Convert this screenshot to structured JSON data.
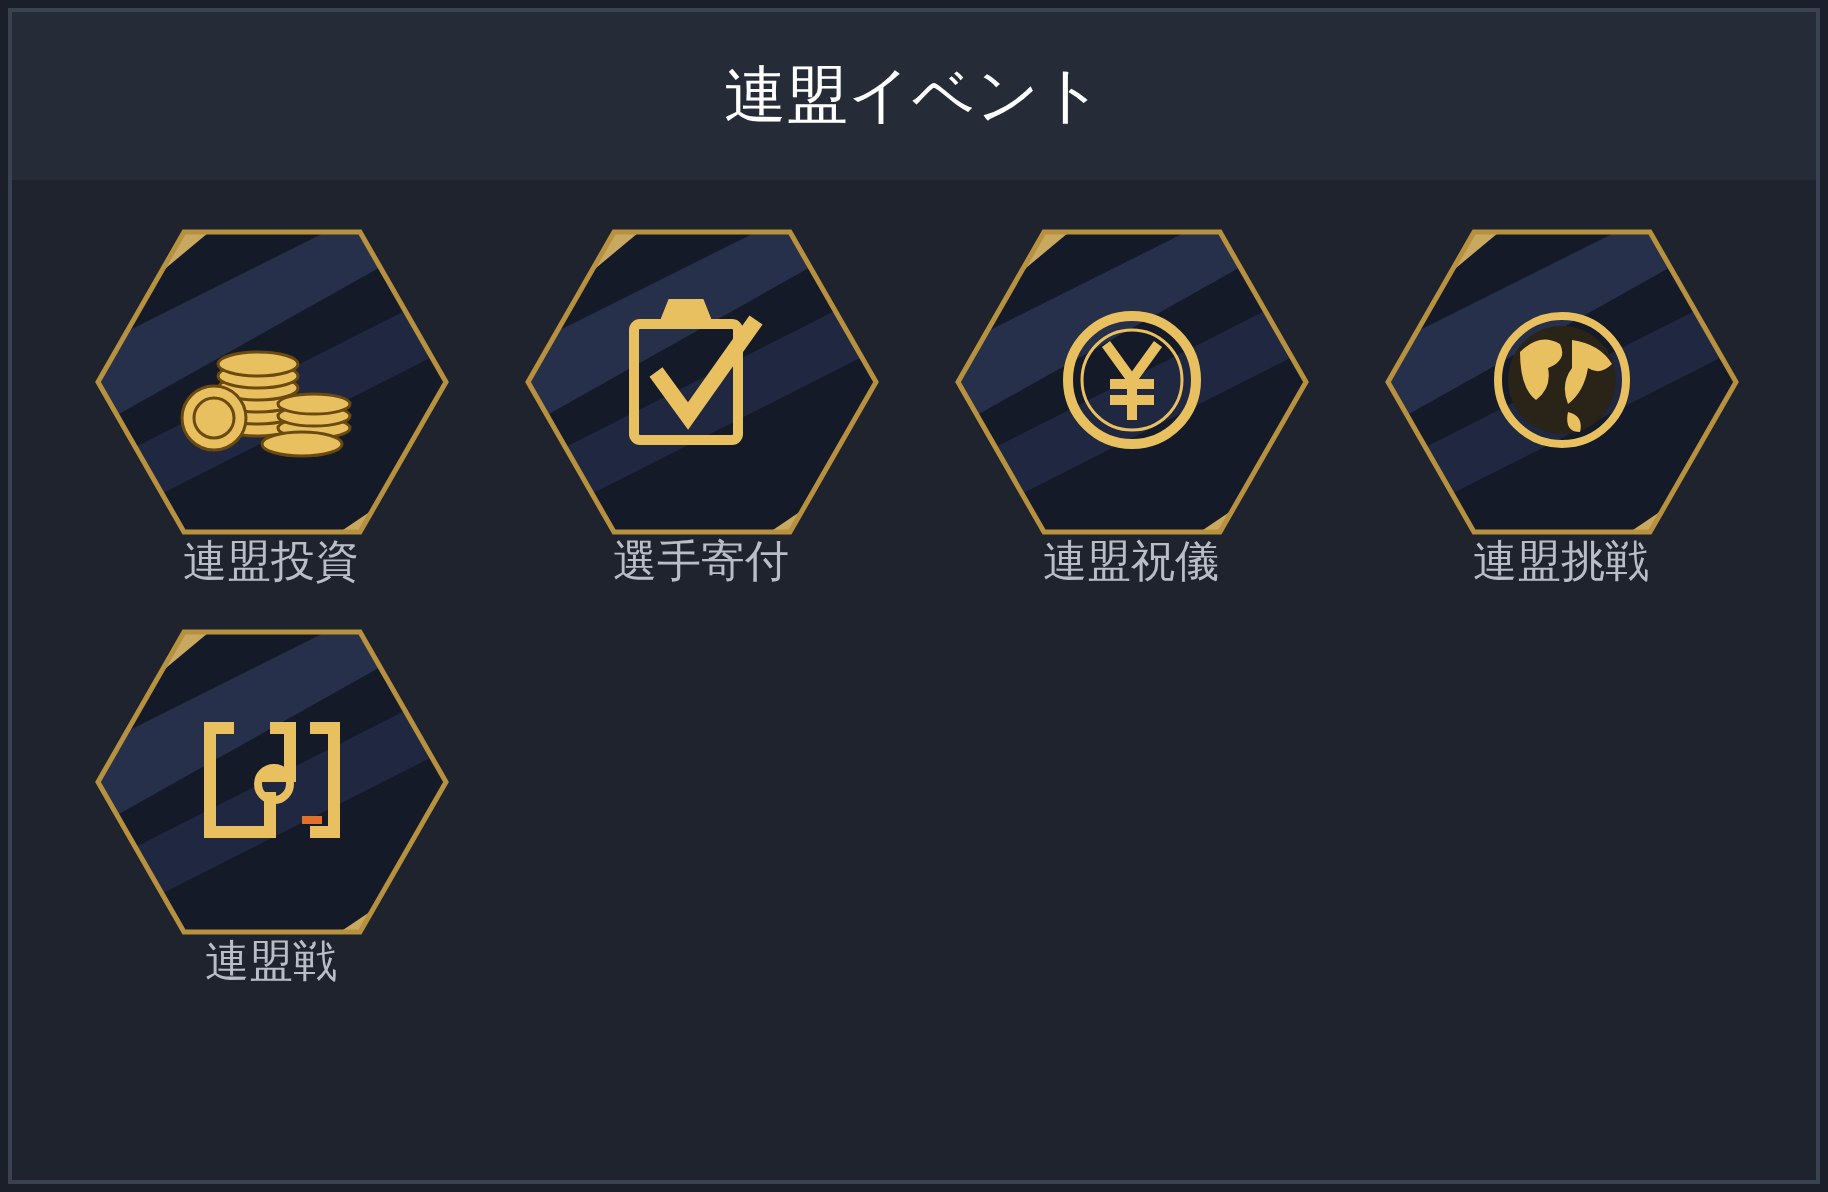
{
  "header": {
    "title": "連盟イベント"
  },
  "events": [
    {
      "label": "連盟投資",
      "kind": "coins"
    },
    {
      "label": "選手寄付",
      "kind": "clipboard"
    },
    {
      "label": "連盟祝儀",
      "kind": "yen"
    },
    {
      "label": "連盟挑戦",
      "kind": "globe"
    },
    {
      "label": "連盟戦",
      "kind": "bracket"
    }
  ]
}
